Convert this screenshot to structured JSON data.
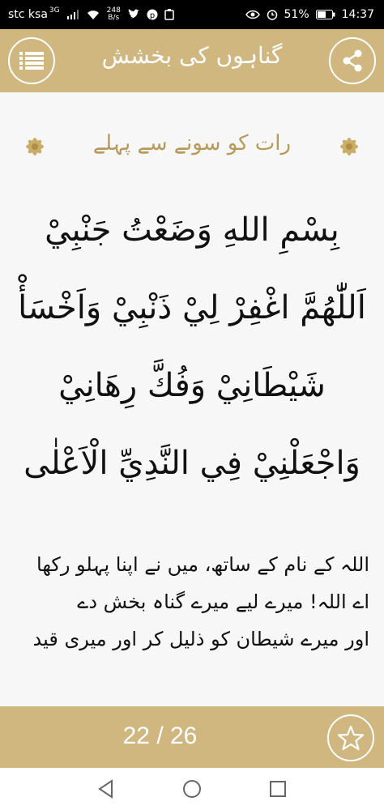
{
  "status": {
    "carrier": "stc ksa",
    "network": "3G",
    "speed_value": "248",
    "speed_unit": "B/s",
    "battery": "51%",
    "time": "14:37"
  },
  "appbar": {
    "title": "گناہوں کی بخشش"
  },
  "content": {
    "heading": "رات کو سونے سے پہلے",
    "arabic_lines": [
      "بِسْمِ اللهِ وَضَعْتُ جَنْبِيْ",
      "اَللّٰهُمَّ اغْفِرْ لِيْ ذَنْبِيْ وَاَخْسَأْ",
      "شَيْطَانِيْ وَفُكَّ رِهَانِيْ",
      "وَاجْعَلْنِيْ فِي النَّدِيِّ الْاَعْلٰى"
    ],
    "translation_lines": [
      "اللہ کے نام کے ساتھ، میں نے اپنا پہلو رکھا",
      "اے اللہ! میرے لیے میرے گناہ بخش دے",
      "اور میرے شیطان کو ذلیل کر اور میری قید"
    ]
  },
  "bottombar": {
    "page_counter": "22 / 26"
  },
  "icons": {
    "menu": "menu-list-icon",
    "share": "share-icon",
    "favorite": "star-icon",
    "decor": "flower-icon"
  },
  "colors": {
    "accent": "#cfb77f",
    "heading": "#b79a5a",
    "background": "#f7f7f7"
  }
}
